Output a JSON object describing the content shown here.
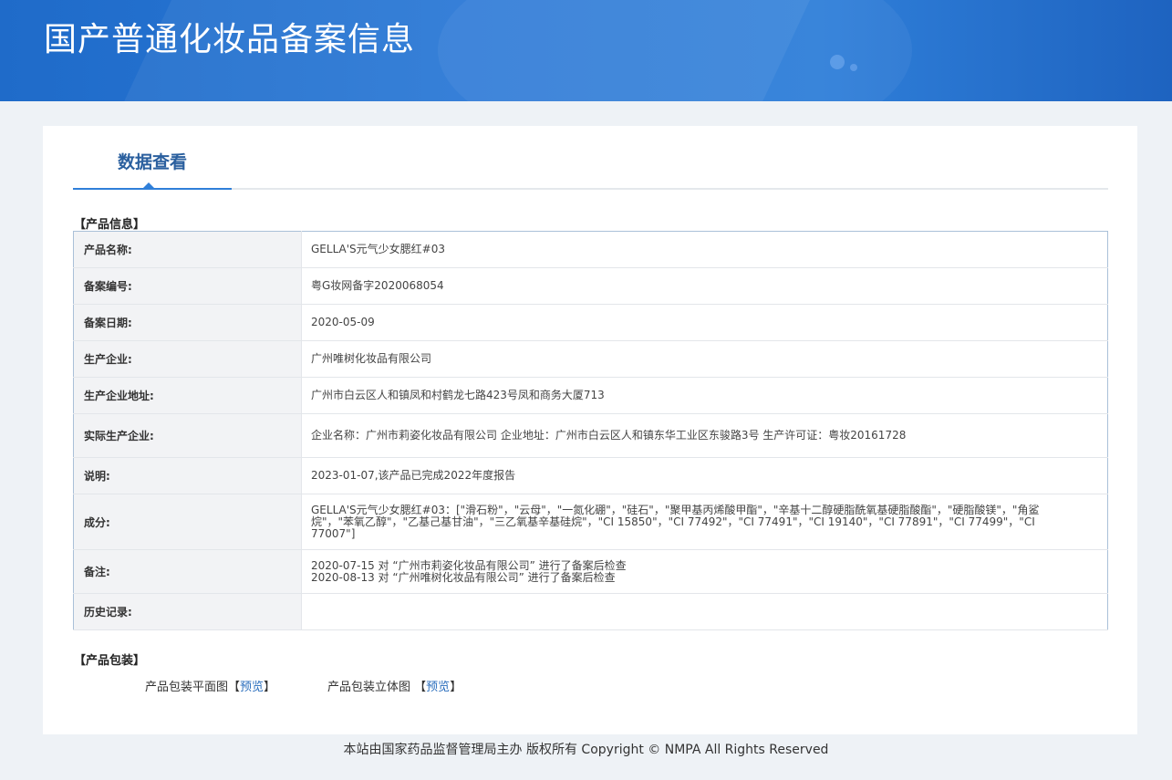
{
  "header": {
    "title": "国产普通化妆品备案信息"
  },
  "tabs": [
    {
      "label": "数据查看"
    }
  ],
  "product_info": {
    "section_title": "【产品信息】",
    "rows": [
      {
        "key": "产品名称:",
        "value": "GELLA'S元气少女腮红#03"
      },
      {
        "key": "备案编号:",
        "value": "粤G妆网备字2020068054"
      },
      {
        "key": "备案日期:",
        "value": "2020-05-09"
      },
      {
        "key": "生产企业:",
        "value": "广州唯树化妆品有限公司"
      },
      {
        "key": "生产企业地址:",
        "value": "广州市白云区人和镇凤和村鹤龙七路423号凤和商务大厦713"
      },
      {
        "key": "实际生产企业:",
        "value": "企业名称：广州市莉姿化妆品有限公司 企业地址：广州市白云区人和镇东华工业区东骏路3号 生产许可证：粤妆20161728"
      },
      {
        "key": "说明:",
        "value": "2023-01-07,该产品已完成2022年度报告"
      },
      {
        "key": "成分:",
        "value": "GELLA'S元气少女腮红#03：[\"滑石粉\"，\"云母\"，\"一氮化硼\"，\"硅石\"，\"聚甲基丙烯酸甲酯\"，\"辛基十二醇硬脂酰氧基硬脂酸酯\"，\"硬脂酸镁\"，\"角鲨烷\"，\"苯氧乙醇\"，\"乙基己基甘油\"，\"三乙氧基辛基硅烷\"，\"CI 15850\"，\"CI 77492\"，\"CI 77491\"，\"CI 19140\"，\"CI 77891\"，\"CI 77499\"，\"CI 77007\"]"
      },
      {
        "key": "备注:",
        "value_lines": [
          "2020-07-15 对 “广州市莉姿化妆品有限公司” 进行了备案后检查",
          "2020-08-13 对 “广州唯树化妆品有限公司” 进行了备案后检查"
        ]
      },
      {
        "key": "历史记录:",
        "value": ""
      }
    ]
  },
  "packaging": {
    "section_title": "【产品包装】",
    "flat_label": "产品包装平面图",
    "flat_link": "预览",
    "solid_label": "产品包装立体图",
    "solid_link": "预览",
    "bracket_open": "【",
    "bracket_close": "】"
  },
  "footer": {
    "text": "本站由国家药品监督管理局主办 版权所有 Copyright © NMPA All Rights Reserved"
  }
}
